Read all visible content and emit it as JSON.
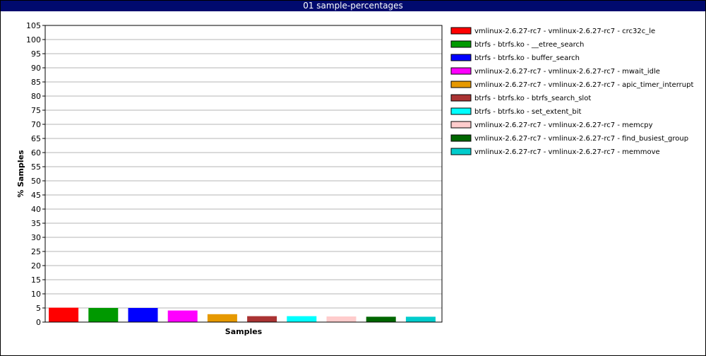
{
  "window": {
    "title": "01 sample-percentages"
  },
  "chart_data": {
    "type": "bar",
    "title": "01 sample-percentages",
    "xlabel": "Samples",
    "ylabel": "% Samples",
    "ylim": [
      0,
      105
    ],
    "yticks": [
      0,
      5,
      10,
      15,
      20,
      25,
      30,
      35,
      40,
      45,
      50,
      55,
      60,
      65,
      70,
      75,
      80,
      85,
      90,
      95,
      100,
      105
    ],
    "grid": true,
    "legend_position": "right",
    "series": [
      {
        "name": "vmlinux-2.6.27-rc7 - vmlinux-2.6.27-rc7 - crc32c_le",
        "value": 5.1,
        "color": "#ff0000"
      },
      {
        "name": "btrfs - btrfs.ko - __etree_search",
        "value": 5.0,
        "color": "#009900"
      },
      {
        "name": "btrfs - btrfs.ko - buffer_search",
        "value": 5.0,
        "color": "#0000ff"
      },
      {
        "name": "vmlinux-2.6.27-rc7 - vmlinux-2.6.27-rc7 - mwait_idle",
        "value": 4.1,
        "color": "#ff00ff"
      },
      {
        "name": "vmlinux-2.6.27-rc7 - vmlinux-2.6.27-rc7 - apic_timer_interrupt",
        "value": 2.8,
        "color": "#e69900"
      },
      {
        "name": "btrfs - btrfs.ko - btrfs_search_slot",
        "value": 2.1,
        "color": "#aa3333"
      },
      {
        "name": "btrfs - btrfs.ko - set_extent_bit",
        "value": 2.1,
        "color": "#00ffff"
      },
      {
        "name": "vmlinux-2.6.27-rc7 - vmlinux-2.6.27-rc7 - memcpy",
        "value": 2.0,
        "color": "#ffcccc"
      },
      {
        "name": "vmlinux-2.6.27-rc7 - vmlinux-2.6.27-rc7 - find_busiest_group",
        "value": 1.9,
        "color": "#006600"
      },
      {
        "name": "vmlinux-2.6.27-rc7 - vmlinux-2.6.27-rc7 - memmove",
        "value": 1.9,
        "color": "#00cccc"
      }
    ]
  }
}
